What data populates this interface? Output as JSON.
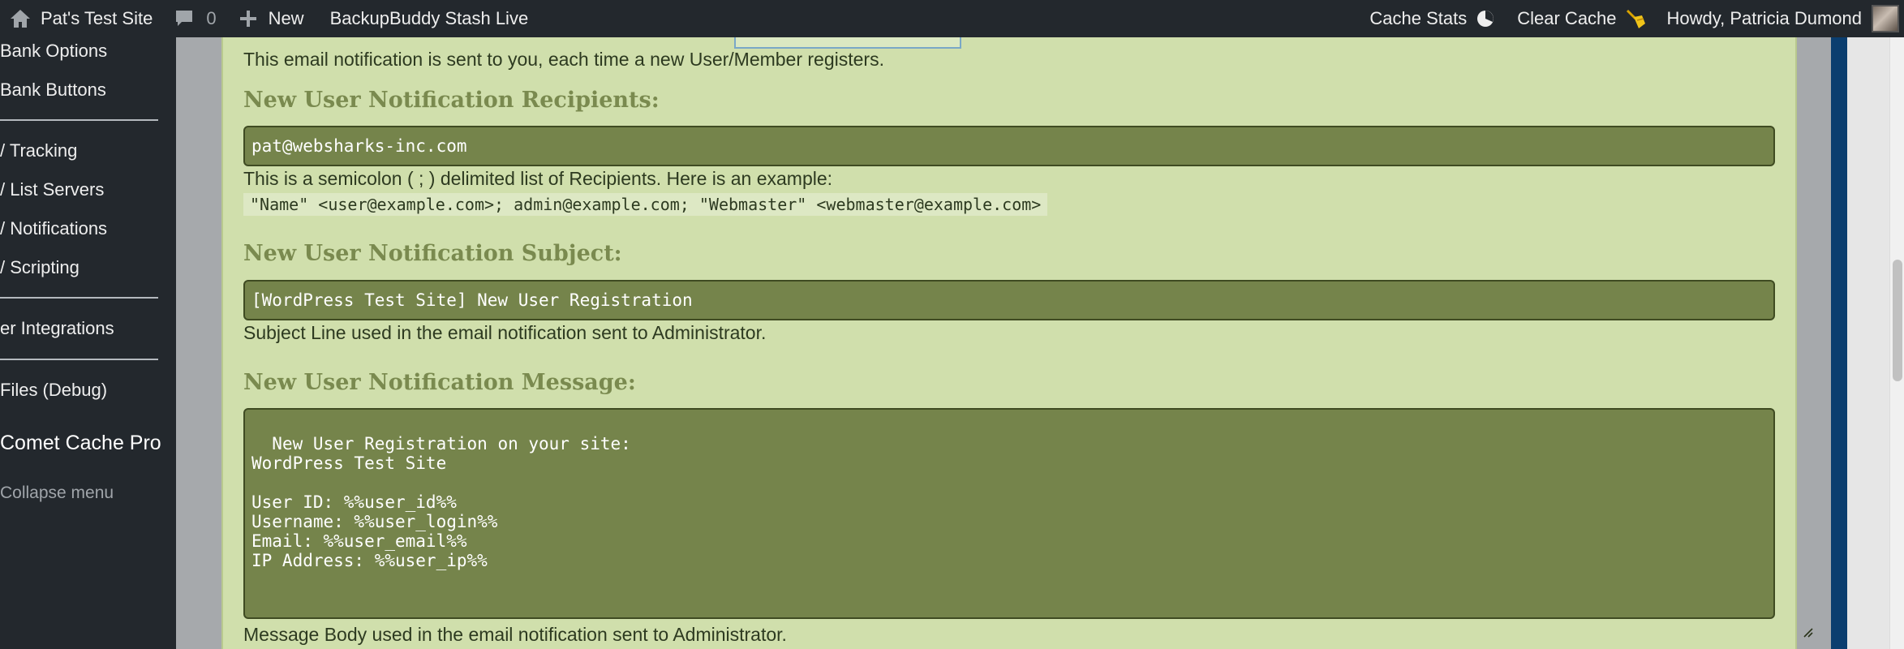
{
  "adminbar": {
    "site_name": "Pat's Test Site",
    "comments_count": "0",
    "new_label": "New",
    "backup_label": "BackupBuddy Stash Live",
    "cache_stats_label": "Cache Stats",
    "clear_cache_label": "Clear Cache",
    "howdy_label": "Howdy, Patricia Dumond"
  },
  "sidebar": {
    "items": [
      "Bank Options",
      "Bank Buttons",
      "/ Tracking",
      "/ List Servers",
      "/ Notifications",
      "/ Scripting",
      "er Integrations",
      "Files (Debug)"
    ],
    "comet_label": "Comet Cache Pro",
    "collapse_label": "Collapse menu"
  },
  "content": {
    "intro_text": "This email notification is sent to you, each time a new User/Member registers.",
    "recipients": {
      "heading": "New User Notification Recipients:",
      "value": "pat@websharks-inc.com",
      "help": "This is a semicolon ( ; ) delimited list of Recipients. Here is an example:",
      "example": "\"Name\" <user@example.com>; admin@example.com; \"Webmaster\" <webmaster@example.com>"
    },
    "subject": {
      "heading": "New User Notification Subject:",
      "value": "[WordPress Test Site] New User Registration",
      "help": "Subject Line used in the email notification sent to Administrator."
    },
    "message": {
      "heading": "New User Notification Message:",
      "value": "New User Registration on your site:\nWordPress Test Site\n\nUser ID: %%user_id%%\nUsername: %%user_login%%\nEmail: %%user_email%%\nIP Address: %%user_ip%%",
      "help": "Message Body used in the email notification sent to Administrator."
    }
  },
  "colors": {
    "adminbar_bg": "#23282d",
    "panel_bg": "#d0dfac",
    "field_bg": "#75844b",
    "heading": "#7a8a4f"
  }
}
